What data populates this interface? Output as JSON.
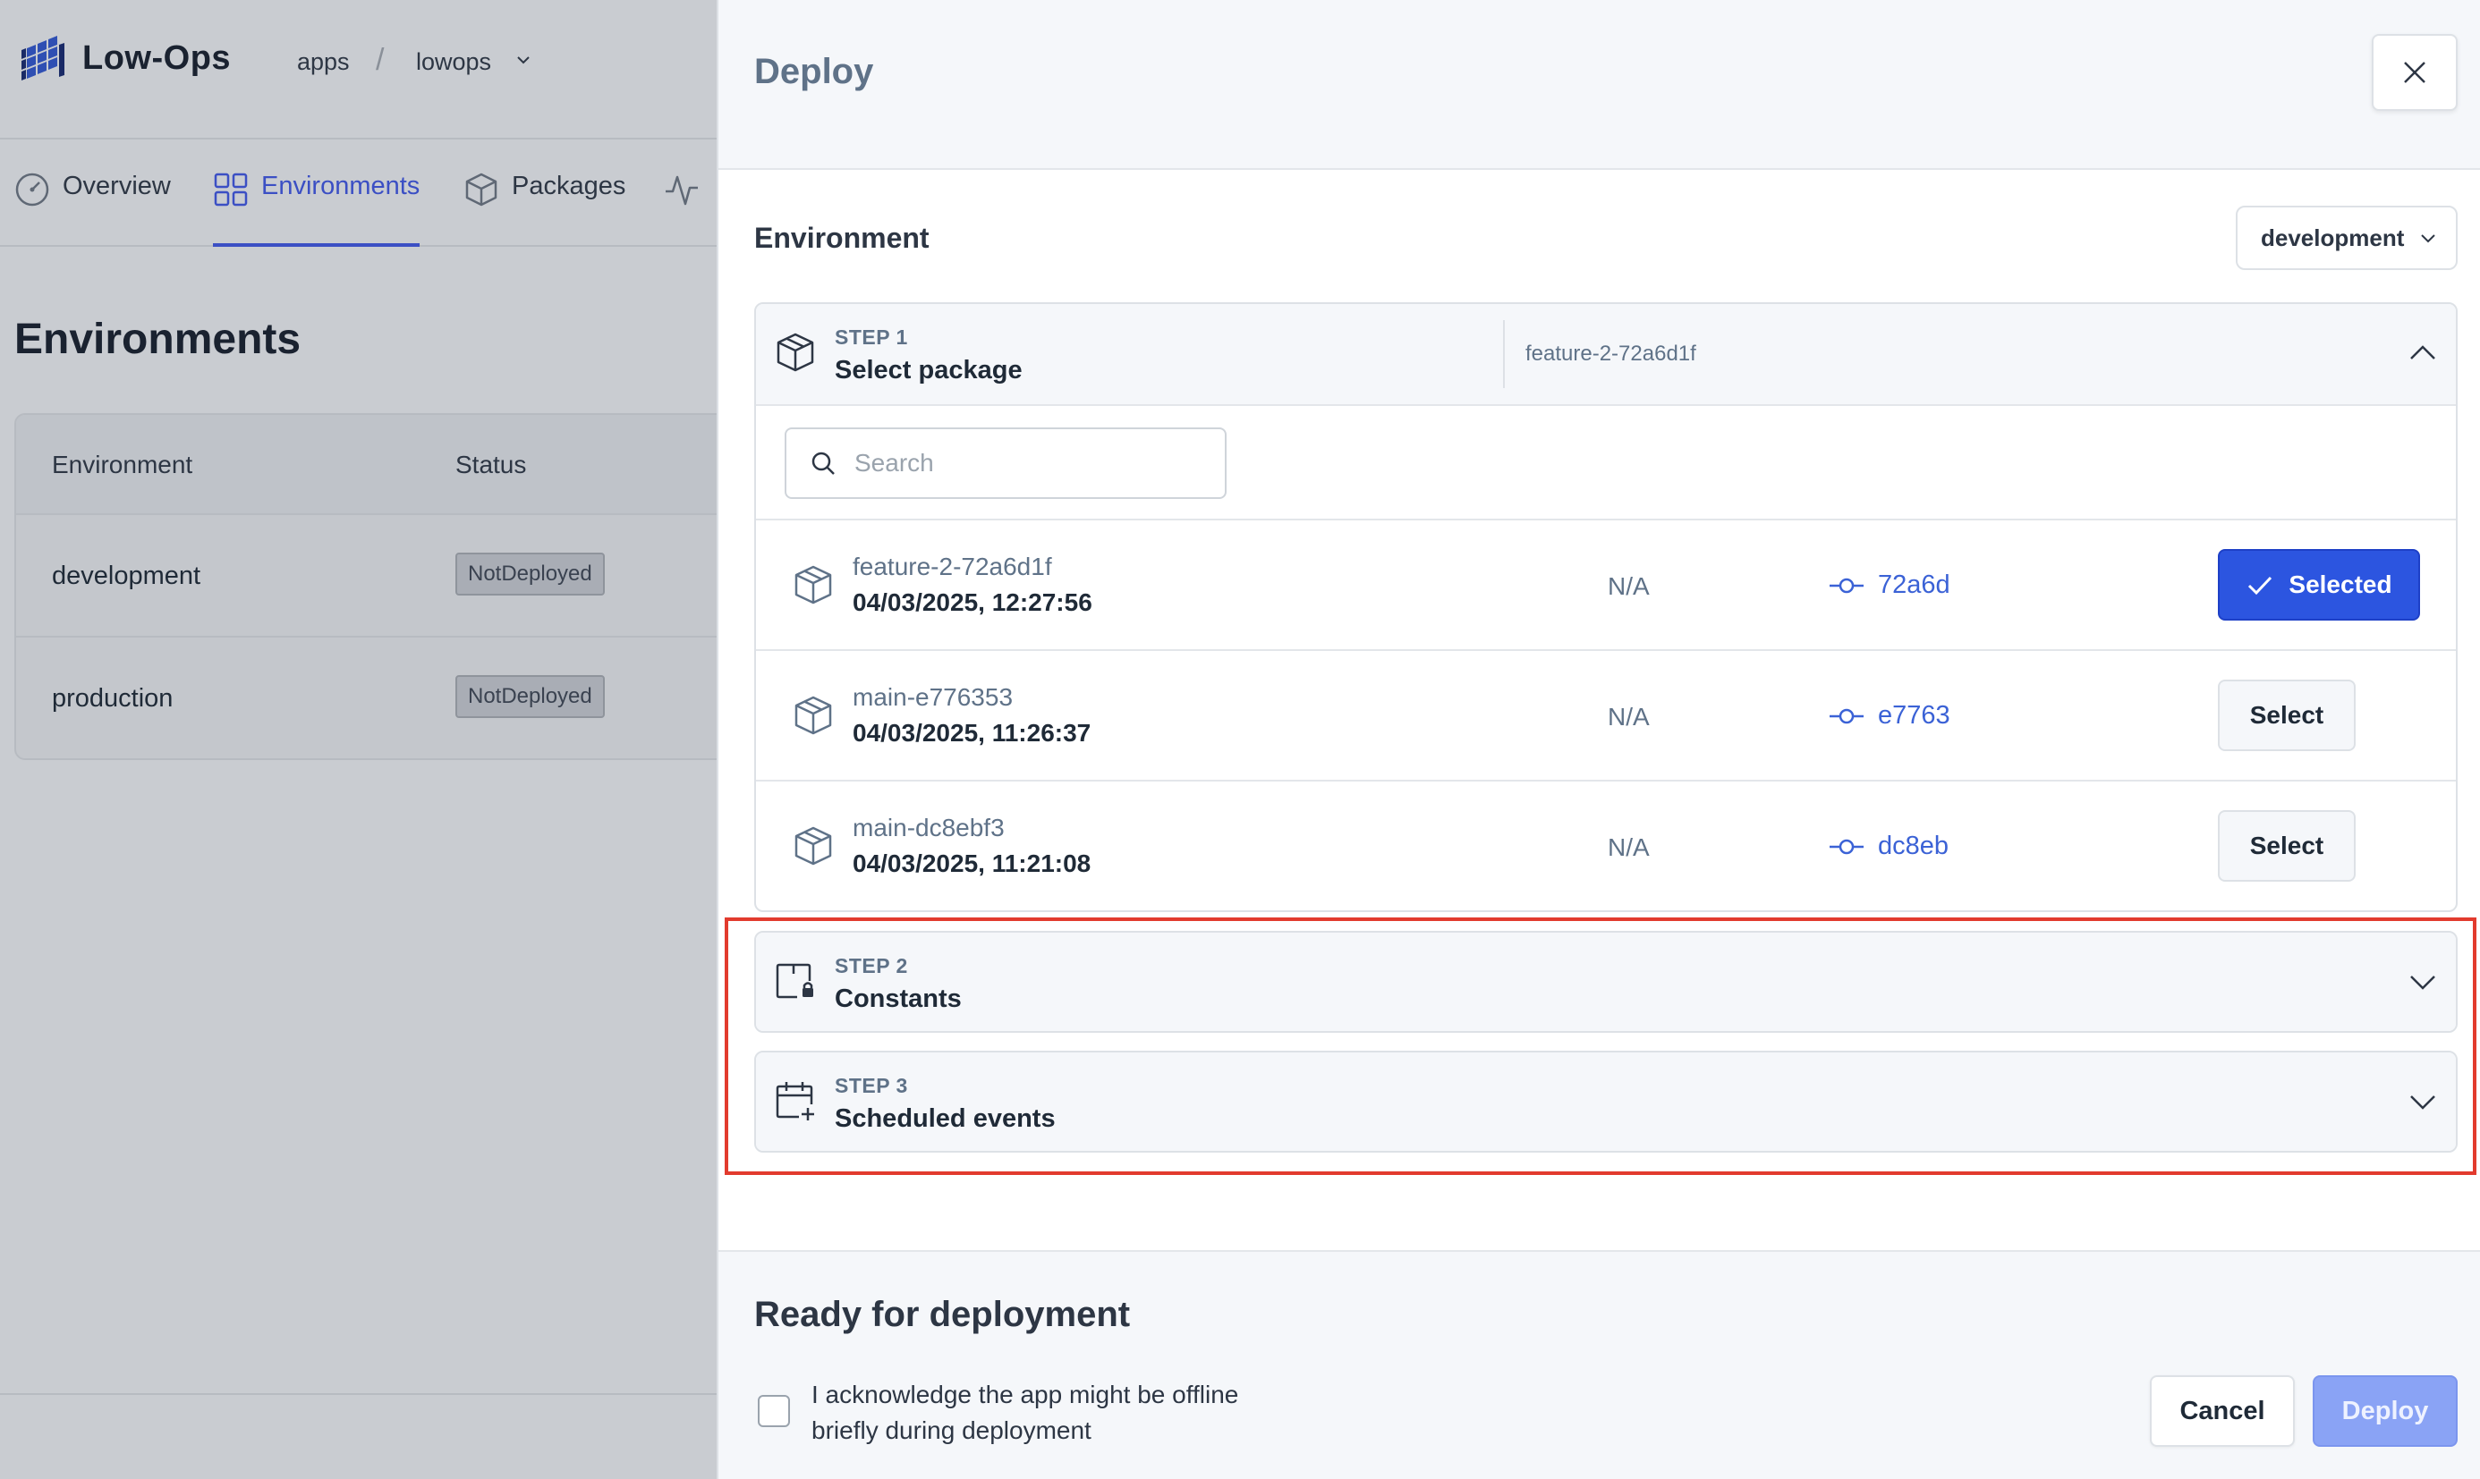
{
  "app": {
    "brand": "Low-Ops",
    "breadcrumb": {
      "root": "apps",
      "separator": "/",
      "current": "lowops"
    }
  },
  "tabs": [
    {
      "label": "Overview",
      "icon": "gauge-icon"
    },
    {
      "label": "Environments",
      "icon": "grid-icon",
      "active": true
    },
    {
      "label": "Packages",
      "icon": "package-icon"
    },
    {
      "label": "",
      "icon": "activity-icon"
    }
  ],
  "environments_page": {
    "title": "Environments",
    "columns": [
      "Environment",
      "Status"
    ],
    "rows": [
      {
        "name": "development",
        "status": "NotDeployed"
      },
      {
        "name": "production",
        "status": "NotDeployed"
      }
    ]
  },
  "drawer": {
    "title": "Deploy",
    "environment_label": "Environment",
    "environment_value": "development",
    "steps": [
      {
        "step": "STEP 1",
        "name": "Select package",
        "selected_value": "feature-2-72a6d1f",
        "expanded": true
      },
      {
        "step": "STEP 2",
        "name": "Constants",
        "expanded": false
      },
      {
        "step": "STEP 3",
        "name": "Scheduled events",
        "expanded": false
      }
    ],
    "search_placeholder": "Search",
    "packages": [
      {
        "name": "feature-2-72a6d1f",
        "date": "04/03/2025, 12:27:56",
        "na": "N/A",
        "commit": "72a6d",
        "button": "Selected",
        "selected": true
      },
      {
        "name": "main-e776353",
        "date": "04/03/2025, 11:26:37",
        "na": "N/A",
        "commit": "e7763",
        "button": "Select",
        "selected": false
      },
      {
        "name": "main-dc8ebf3",
        "date": "04/03/2025, 11:21:08",
        "na": "N/A",
        "commit": "dc8eb",
        "button": "Select",
        "selected": false
      }
    ],
    "footer": {
      "title": "Ready for deployment",
      "acknowledge": "I acknowledge the app might be offline briefly during deployment",
      "cancel": "Cancel",
      "deploy": "Deploy"
    }
  },
  "colors": {
    "accent": "#2c55e0",
    "link": "#3b62d6",
    "highlight": "#e23b2e",
    "deploy_disabled": "#8aa3f5"
  }
}
